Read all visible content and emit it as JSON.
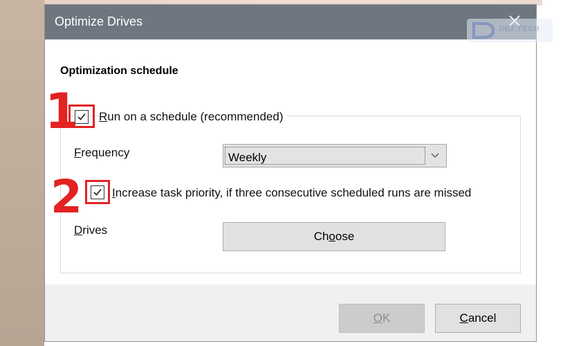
{
  "window": {
    "title": "Optimize Drives"
  },
  "watermark": {
    "text": "DEZ TECH"
  },
  "section": {
    "title": "Optimization schedule"
  },
  "schedule": {
    "checkbox_checked": true,
    "label_prefix": "R",
    "label_rest": "un on a schedule (recommended)",
    "annotation_number": "1"
  },
  "frequency": {
    "label_prefix": "F",
    "label_rest": "requency",
    "selected": "Weekly"
  },
  "priority": {
    "checkbox_checked": true,
    "label_prefix": "I",
    "label_rest": "ncrease task priority, if three consecutive scheduled runs are missed",
    "annotation_number": "2"
  },
  "drives": {
    "label_prefix": "D",
    "label_rest": "rives",
    "button": {
      "pre": "Ch",
      "u": "o",
      "post": "ose"
    }
  },
  "footer": {
    "ok": {
      "u": "O",
      "rest": "K"
    },
    "cancel": {
      "u": "C",
      "rest": "ancel"
    }
  },
  "colors": {
    "titlebar": "#6e7680",
    "annotation": "#e32222"
  }
}
